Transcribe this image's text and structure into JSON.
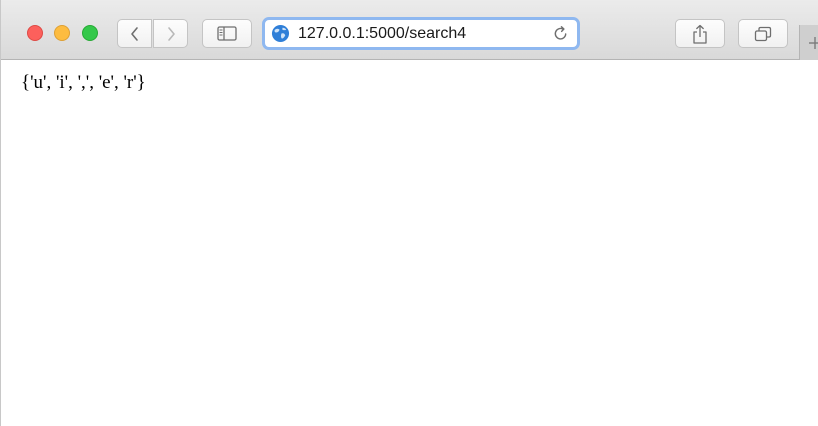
{
  "browser": {
    "address_bar": {
      "url": "127.0.0.1:5000/search4"
    },
    "icons": {
      "back": "chevron-left-icon",
      "forward": "chevron-right-icon",
      "sidebar": "sidebar-icon",
      "site": "globe-icon",
      "reload": "reload-icon",
      "share": "share-icon",
      "tabs": "tabs-overview-icon",
      "new_tab": "plus-icon"
    },
    "colors": {
      "close": "#fc605c",
      "minimize": "#fdbc40",
      "zoom": "#34c84a",
      "address_focus": "#8fb8f0"
    }
  },
  "page": {
    "body_text": "{'u', 'i', ',', 'e', 'r'}"
  }
}
